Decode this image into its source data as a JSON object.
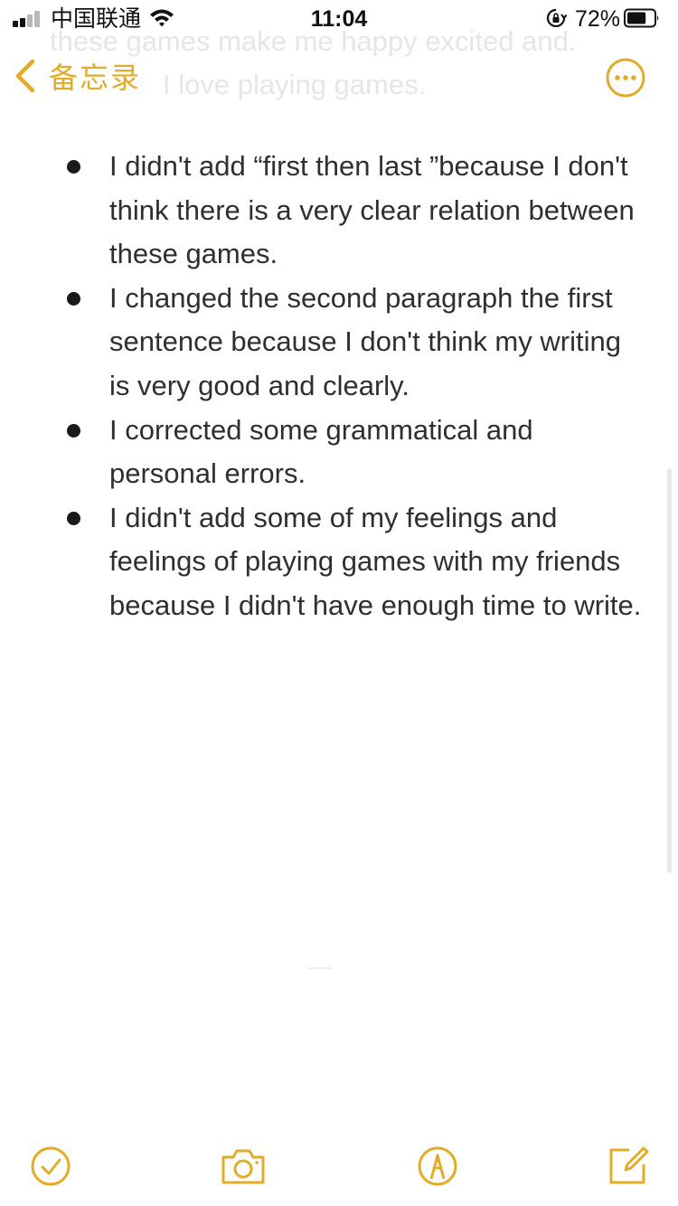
{
  "status_bar": {
    "carrier": "中国联通",
    "time": "11:04",
    "battery_percent": "72%",
    "battery_level": 0.72,
    "signal_bars": 2,
    "icons": [
      "signal-icon",
      "wifi-icon",
      "orientation-lock-icon",
      "battery-icon"
    ]
  },
  "ghost_text": {
    "line1": "these games make me happy excited and.",
    "line2": "I love playing games."
  },
  "nav": {
    "back_label": "备忘录",
    "back_icon": "chevron-left-icon",
    "more_icon": "ellipsis-circle-icon"
  },
  "note": {
    "items": [
      "I didn't add “first then last ”because I don't think there is a very clear relation between these games.",
      "I changed the second paragraph the first sentence because I don't think my writing is very good and clearly.",
      "I corrected some grammatical and personal errors.",
      "I didn't add some of my feelings and feelings of playing games with my friends because I didn't have enough time to write."
    ]
  },
  "toolbar": {
    "icons": [
      "checklist-icon",
      "camera-icon",
      "markup-icon",
      "compose-icon"
    ]
  },
  "colors": {
    "accent": "#e1ad29",
    "text": "#2f2f2f",
    "background": "#ffffff"
  }
}
